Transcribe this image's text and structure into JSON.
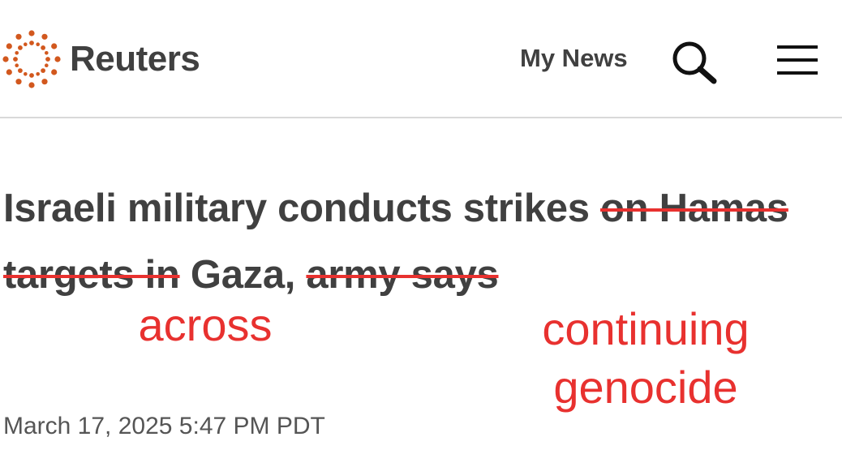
{
  "header": {
    "brand": "Reuters",
    "nav_my_news": "My News",
    "logo_color": "#d2581e"
  },
  "headline": {
    "part1": "Israeli military conducts strikes ",
    "struck1": "on Hamas targets in",
    "part2": " Gaza, ",
    "struck2": "army says"
  },
  "annotations": {
    "across": "across",
    "continuing_line1": "continuing",
    "continuing_line2": "genocide",
    "color": "#e8312f"
  },
  "article": {
    "timestamp": "March 17, 2025 5:47 PM PDT"
  }
}
